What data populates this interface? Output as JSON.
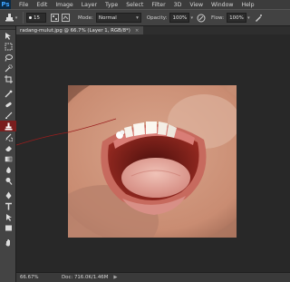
{
  "app": {
    "logo": "Ps"
  },
  "menu": [
    "File",
    "Edit",
    "Image",
    "Layer",
    "Type",
    "Select",
    "Filter",
    "3D",
    "View",
    "Window",
    "Help"
  ],
  "options": {
    "brush_size": "15",
    "mode_label": "Mode:",
    "mode_value": "Normal",
    "opacity_label": "Opacity:",
    "opacity_value": "100%",
    "flow_label": "Flow:",
    "flow_value": "100%"
  },
  "document": {
    "tab_title": "radang-mulut.jpg @ 66.7% (Layer 1, RGB/8*)",
    "close_glyph": "×"
  },
  "status": {
    "zoom": "66.67%",
    "doc_size": "Doc: 716.0K/1.46M",
    "arrow": "▶"
  },
  "colors": {
    "annotation_line": "#9a1e1e",
    "active_tool_bg": "#7a1e1e"
  },
  "tools": [
    "move-tool-icon",
    "marquee-tool-icon",
    "lasso-tool-icon",
    "quick-select-tool-icon",
    "crop-tool-icon",
    "eyedropper-tool-icon",
    "spot-healing-tool-icon",
    "brush-tool-icon",
    "clone-stamp-tool-icon",
    "history-brush-tool-icon",
    "eraser-tool-icon",
    "gradient-tool-icon",
    "blur-tool-icon",
    "dodge-tool-icon",
    "pen-tool-icon",
    "type-tool-icon",
    "path-select-tool-icon",
    "shape-tool-icon",
    "hand-tool-icon"
  ]
}
